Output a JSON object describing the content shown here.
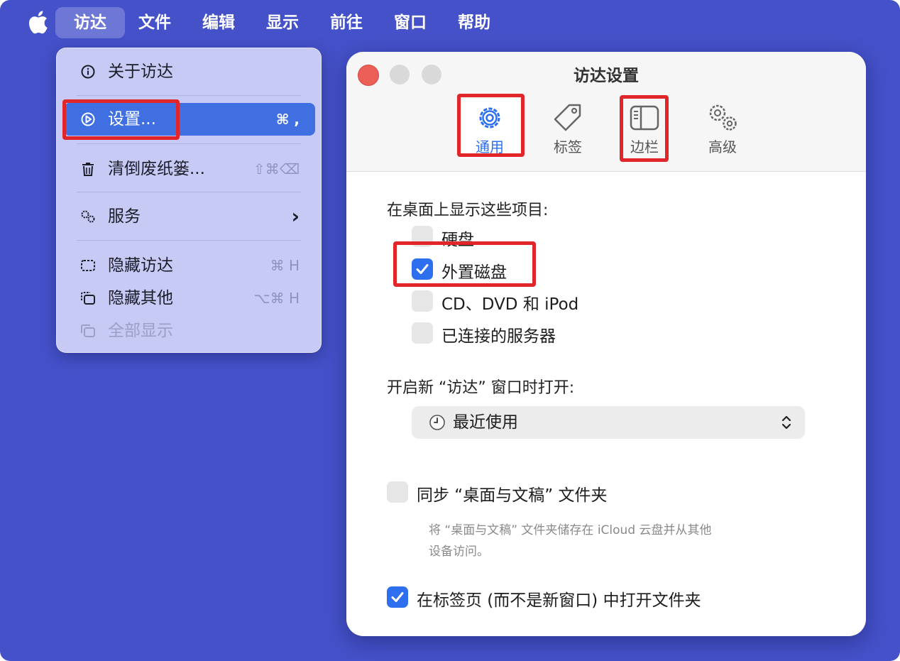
{
  "menubar": {
    "items": [
      "访达",
      "文件",
      "编辑",
      "显示",
      "前往",
      "窗口",
      "帮助"
    ]
  },
  "dropdown": {
    "items": [
      {
        "label": "关于访达",
        "shortcut": "",
        "icon": "info-circle-icon"
      },
      {
        "label": "设置...",
        "shortcut": "⌘ ,",
        "icon": "gear-circle-icon"
      },
      {
        "label": "清倒废纸篓...",
        "shortcut": "⇧⌘⌫",
        "icon": "trash-icon"
      },
      {
        "label": "服务",
        "shortcut": "›",
        "icon": "gears-icon"
      },
      {
        "label": "隐藏访达",
        "shortcut": "⌘ H",
        "icon": "hide-icon"
      },
      {
        "label": "隐藏其他",
        "shortcut": "⌥⌘ H",
        "icon": "hide-others-icon"
      },
      {
        "label": "全部显示",
        "shortcut": "",
        "icon": "show-all-icon"
      }
    ]
  },
  "window": {
    "title": "访达设置",
    "tabs": [
      {
        "label": "通用",
        "icon": "gear-icon"
      },
      {
        "label": "标签",
        "icon": "tag-icon"
      },
      {
        "label": "边栏",
        "icon": "sidebar-icon"
      },
      {
        "label": "高级",
        "icon": "gears-icon"
      }
    ],
    "desktop_section": "在桌面上显示这些项目:",
    "desktop_items": [
      {
        "label": "硬盘",
        "checked": false
      },
      {
        "label": "外置磁盘",
        "checked": true
      },
      {
        "label": "CD、DVD 和 iPod",
        "checked": false
      },
      {
        "label": "已连接的服务器",
        "checked": false
      }
    ],
    "new_window_label": "开启新 “访达” 窗口时打开:",
    "new_window_value": "最近使用",
    "sync_label": "同步 “桌面与文稿” 文件夹",
    "sync_checked": false,
    "sync_help_1": "将 “桌面与文稿” 文件夹储存在 iCloud 云盘并从其他",
    "sync_help_2": "设备访问。",
    "tabs_label": "在标签页 (而不是新窗口) 中打开文件夹",
    "tabs_checked": true
  },
  "colors": {
    "desktop": "#4451c9",
    "accent": "#2e6ff0",
    "highlight": "#e0262b"
  }
}
